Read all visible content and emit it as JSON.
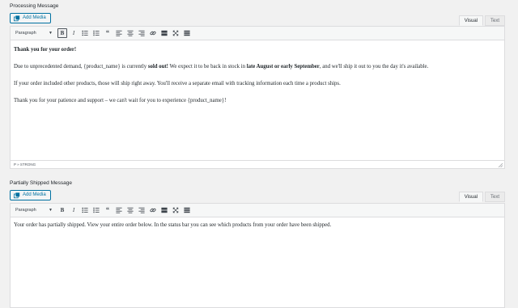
{
  "sections": [
    {
      "label": "Processing Message",
      "add_media": "Add Media",
      "tabs": {
        "visual": "Visual",
        "text": "Text"
      },
      "format_select": "Paragraph",
      "paragraphs": {
        "p1": {
          "bold": "Thank you for your order!"
        },
        "p2": {
          "a": "Due to unprecedented demand, {product_name} is currently ",
          "b": "sold out!",
          "c": " We expect it to be back in stock in ",
          "d": "late August or early September",
          "e": ", and we'll ship it out to you the day it's available."
        },
        "p3": "If your order included other products, those will ship right away. You'll receive a separate email with tracking information each time a product ships.",
        "p4": "Thank you for your patience and support – we can't wait for you to experience {product_name}!"
      },
      "status_path": "P » STRONG"
    },
    {
      "label": "Partially Shipped Message",
      "add_media": "Add Media",
      "tabs": {
        "visual": "Visual",
        "text": "Text"
      },
      "format_select": "Paragraph",
      "paragraphs": {
        "p1": "Your order has partially shipped. View your entire order below. In the status bar you can see which products from your order have been shipped."
      }
    }
  ],
  "toolbar_icons": [
    "bold-icon",
    "italic-icon",
    "bulleted-list-icon",
    "numbered-list-icon",
    "blockquote-icon",
    "align-left-icon",
    "align-center-icon",
    "align-right-icon",
    "link-icon",
    "insert-read-more-icon",
    "fullscreen-icon",
    "toolbar-toggle-icon"
  ],
  "colors": {
    "accent": "#0071a1",
    "border": "#dcdcde",
    "background": "#f1f1f1"
  }
}
